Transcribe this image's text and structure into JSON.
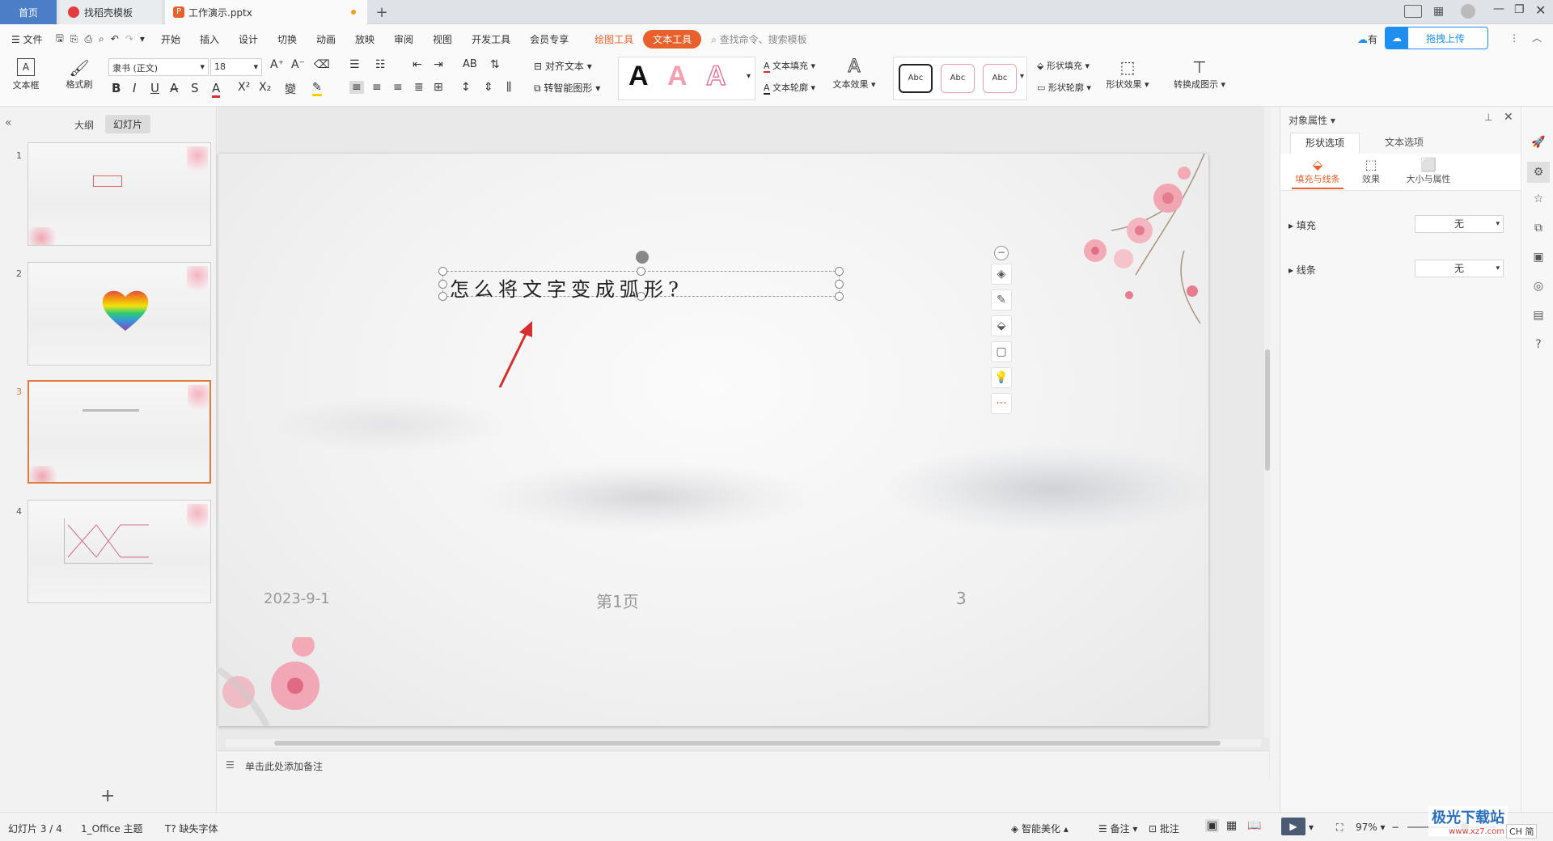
{
  "tabs": {
    "home": "首页",
    "templates": "找稻壳模板",
    "document": "工作演示.pptx"
  },
  "menu": {
    "file": "文件",
    "items": [
      "开始",
      "插入",
      "设计",
      "切换",
      "动画",
      "放映",
      "审阅",
      "视图",
      "开发工具",
      "会员专享"
    ],
    "drawing_tools": "绘图工具",
    "text_tools": "文本工具",
    "search_placeholder": "查找命令、搜索模板",
    "upload": "拖拽上传",
    "has_label": "有"
  },
  "ribbon": {
    "textbox": "文本框",
    "format_painter": "格式刷",
    "font_name": "隶书 (正文)",
    "font_size": "18",
    "align_text": "对齐文本",
    "smart_shape": "转智能图形",
    "text_fill": "文本填充",
    "text_outline": "文本轮廓",
    "text_effect": "文本效果",
    "style_a": "A",
    "abc": "Abc",
    "shape_fill": "形状填充",
    "shape_outline": "形状轮廓",
    "shape_effect": "形状效果",
    "convert_diagram": "转换成图示"
  },
  "left_panel": {
    "outline_tab": "大纲",
    "slides_tab": "幻灯片",
    "slide_numbers": [
      "1",
      "2",
      "3",
      "4"
    ]
  },
  "slide": {
    "title_text": "怎么将文字变成弧形?",
    "footer_date": "2023-9-1",
    "footer_page": "第1页",
    "page_num": "3"
  },
  "notes_placeholder": "单击此处添加备注",
  "right_panel": {
    "title": "对象属性",
    "tab_shape": "形状选项",
    "tab_text": "文本选项",
    "sub_fill_line": "填充与线条",
    "sub_effect": "效果",
    "sub_size": "大小与属性",
    "fill_label": "填充",
    "fill_value": "无",
    "line_label": "线条",
    "line_value": "无"
  },
  "status": {
    "slide_count": "幻灯片 3 / 4",
    "theme": "1_Office 主题",
    "missing_font": "缺失字体",
    "smart_beautify": "智能美化",
    "notes": "备注",
    "comments": "批注",
    "zoom": "97%",
    "watermark": "极光下载站",
    "watermark_url": "www.xz7.com",
    "ime": "CH 简"
  },
  "colors": {
    "accent_orange": "#e8612c",
    "text_tools_bg": "#e8612c",
    "upload_blue": "#1e8ff0",
    "selected_thumb": "#e07b3d",
    "arrow_red": "#d62f2f"
  }
}
